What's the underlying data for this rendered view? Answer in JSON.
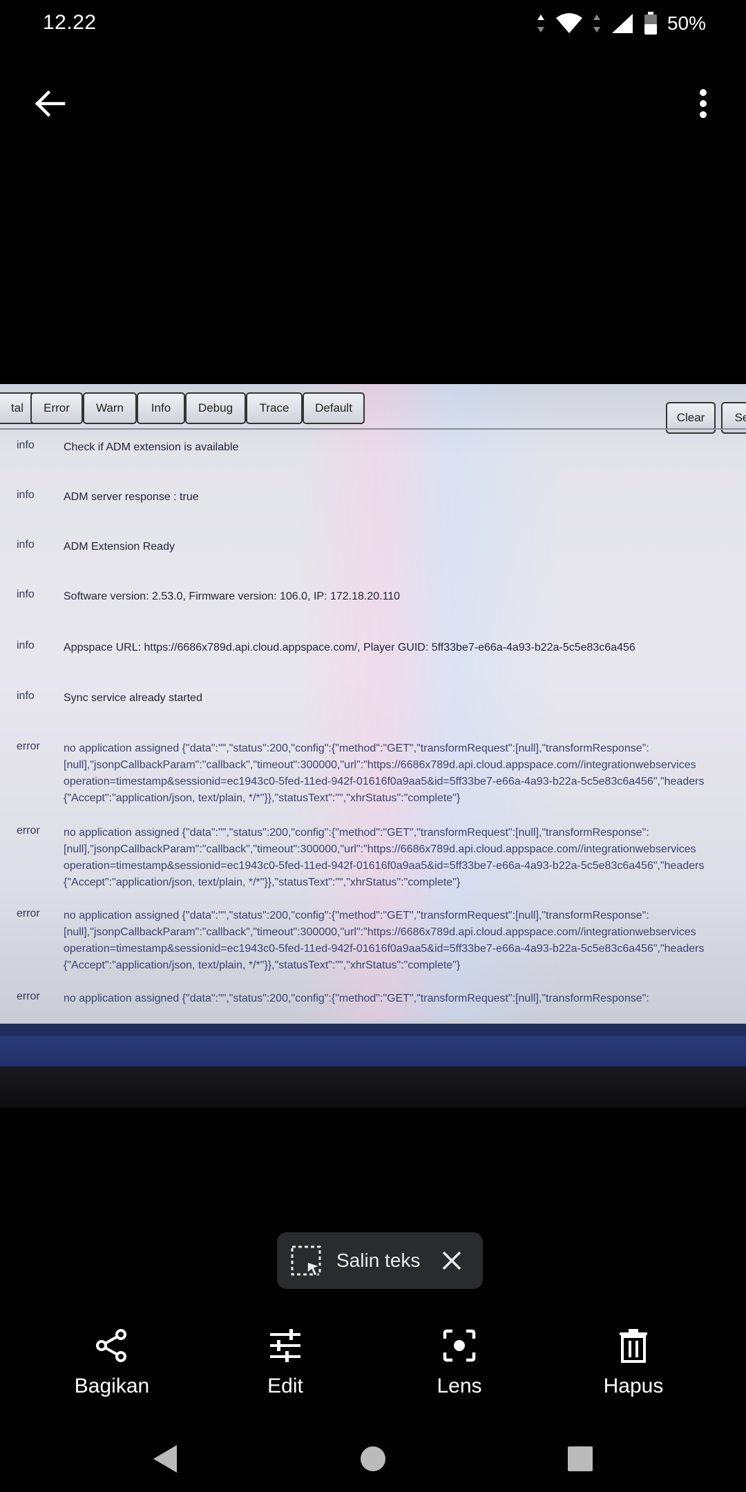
{
  "status_bar": {
    "time": "12.22",
    "battery": "50%"
  },
  "toolbar": {
    "buttons": [
      "tal",
      "Error",
      "Warn",
      "Info",
      "Debug",
      "Trace",
      "Default"
    ],
    "clear": "Clear",
    "partial": "Se"
  },
  "log": [
    {
      "level": "info",
      "lines": [
        "Check if ADM extension is available"
      ]
    },
    {
      "level": "info",
      "lines": [
        "ADM server response : true"
      ]
    },
    {
      "level": "info",
      "lines": [
        "ADM Extension Ready"
      ]
    },
    {
      "level": "info",
      "lines": [
        "Software version: 2.53.0, Firmware version: 106.0, IP: 172.18.20.110"
      ]
    },
    {
      "level": "info",
      "lines": [
        "Appspace URL: https://6686x789d.api.cloud.appspace.com/, Player GUID: 5ff33be7-e66a-4a93-b22a-5c5e83c6a456"
      ]
    },
    {
      "level": "info",
      "lines": [
        "Sync service already started"
      ]
    },
    {
      "level": "error",
      "lines": [
        "no application assigned {\"data\":\"\",\"status\":200,\"config\":{\"method\":\"GET\",\"transformRequest\":[null],\"transformResponse\":",
        "[null],\"jsonpCallbackParam\":\"callback\",\"timeout\":300000,\"url\":\"https://6686x789d.api.cloud.appspace.com//integrationwebservices",
        "operation=timestamp&sessionid=ec1943c0-5fed-11ed-942f-01616f0a9aa5&id=5ff33be7-e66a-4a93-b22a-5c5e83c6a456\",\"headers",
        "{\"Accept\":\"application/json, text/plain, */*\"}},\"statusText\":\"\",\"xhrStatus\":\"complete\"}"
      ]
    },
    {
      "level": "error",
      "lines": [
        "no application assigned {\"data\":\"\",\"status\":200,\"config\":{\"method\":\"GET\",\"transformRequest\":[null],\"transformResponse\":",
        "[null],\"jsonpCallbackParam\":\"callback\",\"timeout\":300000,\"url\":\"https://6686x789d.api.cloud.appspace.com//integrationwebservices",
        "operation=timestamp&sessionid=ec1943c0-5fed-11ed-942f-01616f0a9aa5&id=5ff33be7-e66a-4a93-b22a-5c5e83c6a456\",\"headers",
        "{\"Accept\":\"application/json, text/plain, */*\"}},\"statusText\":\"\",\"xhrStatus\":\"complete\"}"
      ]
    },
    {
      "level": "error",
      "lines": [
        "no application assigned {\"data\":\"\",\"status\":200,\"config\":{\"method\":\"GET\",\"transformRequest\":[null],\"transformResponse\":",
        "[null],\"jsonpCallbackParam\":\"callback\",\"timeout\":300000,\"url\":\"https://6686x789d.api.cloud.appspace.com//integrationwebservices",
        "operation=timestamp&sessionid=ec1943c0-5fed-11ed-942f-01616f0a9aa5&id=5ff33be7-e66a-4a93-b22a-5c5e83c6a456\",\"headers",
        "{\"Accept\":\"application/json, text/plain, */*\"}},\"statusText\":\"\",\"xhrStatus\":\"complete\"}"
      ]
    },
    {
      "level": "error",
      "lines": [
        "no application assigned {\"data\":\"\",\"status\":200,\"config\":{\"method\":\"GET\",\"transformRequest\":[null],\"transformResponse\":"
      ]
    }
  ],
  "chip": {
    "label": "Salin teks"
  },
  "actions": {
    "share": "Bagikan",
    "edit": "Edit",
    "lens": "Lens",
    "delete": "Hapus"
  }
}
